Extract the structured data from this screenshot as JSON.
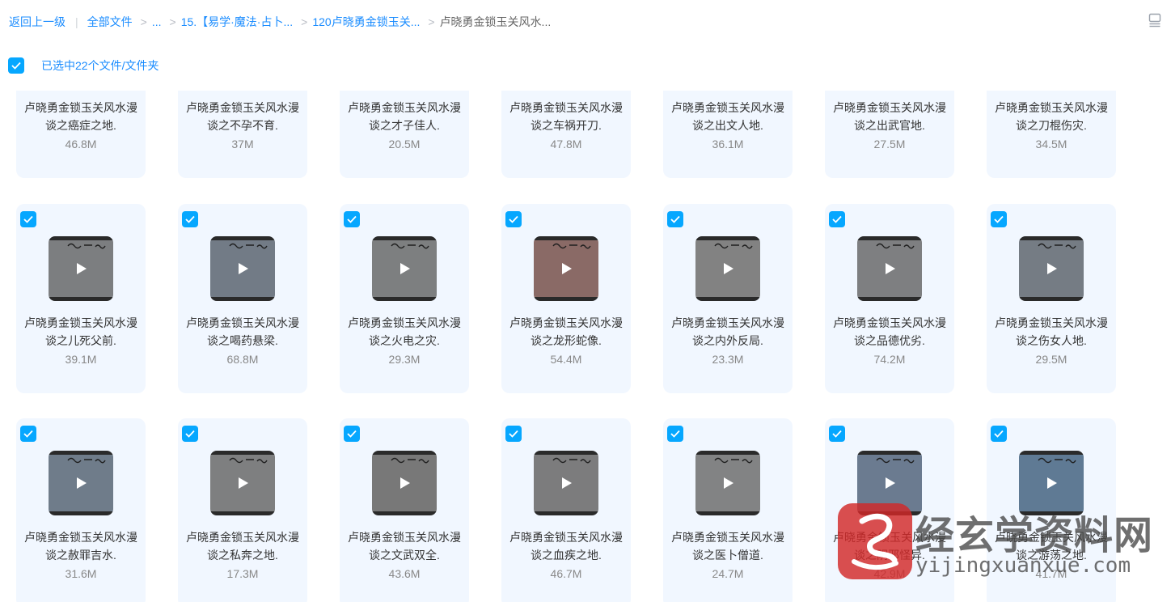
{
  "breadcrumb": {
    "back": "返回上一级",
    "all_files": "全部文件",
    "ellipsis": "...",
    "folder_1": "15.【易学·魔法·占卜...",
    "folder_2": "120卢晓勇金锁玉关...",
    "current": "卢晓勇金锁玉关风水..."
  },
  "selection": {
    "text": "已选中22个文件/文件夹"
  },
  "files": [
    {
      "name": "卢晓勇金锁玉关风水漫谈之癌症之地.",
      "size": "46.8M",
      "tone": "#77797c"
    },
    {
      "name": "卢晓勇金锁玉关风水漫谈之不孕不育.",
      "size": "37M",
      "tone": "#7a7c80"
    },
    {
      "name": "卢晓勇金锁玉关风水漫谈之才子佳人.",
      "size": "20.5M",
      "tone": "#7b7d80"
    },
    {
      "name": "卢晓勇金锁玉关风水漫谈之车祸开刀.",
      "size": "47.8M",
      "tone": "#78797c"
    },
    {
      "name": "卢晓勇金锁玉关风水漫谈之出文人地.",
      "size": "36.1M",
      "tone": "#797b7e"
    },
    {
      "name": "卢晓勇金锁玉关风水漫谈之出武官地.",
      "size": "27.5M",
      "tone": "#7a7c7f"
    },
    {
      "name": "卢晓勇金锁玉关风水漫谈之刀棍伤灾.",
      "size": "34.5M",
      "tone": "#787a7e"
    },
    {
      "name": "卢晓勇金锁玉关风水漫谈之儿死父前.",
      "size": "39.1M",
      "tone": "#7c7e80"
    },
    {
      "name": "卢晓勇金锁玉关风水漫谈之喝药悬梁.",
      "size": "68.8M",
      "tone": "#727b86"
    },
    {
      "name": "卢晓勇金锁玉关风水漫谈之火电之灾.",
      "size": "29.3M",
      "tone": "#7d7f80"
    },
    {
      "name": "卢晓勇金锁玉关风水漫谈之龙形蛇像.",
      "size": "54.4M",
      "tone": "#8a6a66"
    },
    {
      "name": "卢晓勇金锁玉关风水漫谈之内外反局.",
      "size": "23.3M",
      "tone": "#828282"
    },
    {
      "name": "卢晓勇金锁玉关风水漫谈之品德优劣.",
      "size": "74.2M",
      "tone": "#7e7f81"
    },
    {
      "name": "卢晓勇金锁玉关风水漫谈之伤女人地.",
      "size": "29.5M",
      "tone": "#757c84"
    },
    {
      "name": "卢晓勇金锁玉关风水漫谈之赦罪吉水.",
      "size": "31.6M",
      "tone": "#6f7c8a"
    },
    {
      "name": "卢晓勇金锁玉关风水漫谈之私奔之地.",
      "size": "17.3M",
      "tone": "#7e7f80"
    },
    {
      "name": "卢晓勇金锁玉关风水漫谈之文武双全.",
      "size": "43.6M",
      "tone": "#787878"
    },
    {
      "name": "卢晓勇金锁玉关风水漫谈之血疾之地.",
      "size": "46.7M",
      "tone": "#7c7c7d"
    },
    {
      "name": "卢晓勇金锁玉关风水漫谈之医卜僧道.",
      "size": "24.7M",
      "tone": "#828384"
    },
    {
      "name": "卢晓勇金锁玉关风水漫谈之阴邪怪异.",
      "size": "42.9M",
      "tone": "#6b7b90"
    },
    {
      "name": "卢晓勇金锁玉关风水漫谈之游荡之地.",
      "size": "41.7M",
      "tone": "#5f7a94"
    }
  ],
  "watermark": {
    "cn": "经玄学资料网",
    "en": "yijingxuanxue.com"
  },
  "colors": {
    "accent": "#06a7ff",
    "link": "#1a8cff",
    "card_bg": "#f1f7ff"
  }
}
